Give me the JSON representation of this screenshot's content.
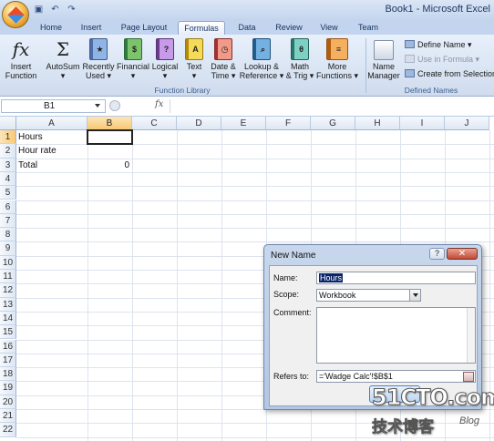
{
  "window": {
    "title": "Book1 - Microsoft Excel"
  },
  "quick_access": [
    "save-icon",
    "undo-icon",
    "redo-icon"
  ],
  "ribbon_tabs": [
    {
      "label": "Home",
      "active": false
    },
    {
      "label": "Insert",
      "active": false
    },
    {
      "label": "Page Layout",
      "active": false
    },
    {
      "label": "Formulas",
      "active": true
    },
    {
      "label": "Data",
      "active": false
    },
    {
      "label": "Review",
      "active": false
    },
    {
      "label": "View",
      "active": false
    },
    {
      "label": "Team",
      "active": false
    }
  ],
  "function_library": {
    "group_label": "Function Library",
    "insert_function": {
      "glyph": "fx",
      "line1": "Insert",
      "line2": "Function"
    },
    "autosum": {
      "glyph": "Σ",
      "line1": "AutoSum",
      "line2": "▾"
    },
    "recently_used": {
      "line1": "Recently",
      "line2": "Used ▾"
    },
    "financial": {
      "line1": "Financial",
      "line2": "▾",
      "glyph": "$"
    },
    "logical": {
      "line1": "Logical",
      "line2": "▾",
      "glyph": "?"
    },
    "text": {
      "line1": "Text",
      "line2": "▾",
      "glyph": "A"
    },
    "date_time": {
      "line1": "Date &",
      "line2": "Time ▾",
      "glyph": "◷"
    },
    "lookup_reference": {
      "line1": "Lookup &",
      "line2": "Reference ▾",
      "glyph": "⌕"
    },
    "math_trig": {
      "line1": "Math",
      "line2": "& Trig ▾",
      "glyph": "θ"
    },
    "more_functions": {
      "line1": "More",
      "line2": "Functions ▾"
    }
  },
  "defined_names": {
    "group_label": "Defined Names",
    "name_manager": {
      "line1": "Name",
      "line2": "Manager"
    },
    "define_name": "Define Name ▾",
    "use_in_formula": "Use in Formula ▾",
    "create_from_selection": "Create from Selection"
  },
  "formula_bar": {
    "name_box": "B1",
    "fx_label": "fx",
    "formula": ""
  },
  "sheet": {
    "columns": [
      "A",
      "B",
      "C",
      "D",
      "E",
      "F",
      "G",
      "H",
      "I",
      "J"
    ],
    "selected_column": "B",
    "rows": [
      "1",
      "2",
      "3",
      "4",
      "5",
      "6",
      "7",
      "8",
      "9",
      "10",
      "11",
      "12",
      "13",
      "14",
      "15",
      "16",
      "17",
      "18",
      "19",
      "20",
      "21",
      "22"
    ],
    "selected_row": "1",
    "cells": {
      "A1": "Hours",
      "A2": "Hour rate",
      "A3": "Total",
      "B3": "0"
    }
  },
  "dialog": {
    "title": "New Name",
    "help_label": "?",
    "close_label": "✕",
    "name_label": "Name:",
    "name_value": "Hours",
    "scope_label": "Scope:",
    "scope_value": "Workbook",
    "comment_label": "Comment:",
    "comment_value": "",
    "refers_label": "Refers to:",
    "refers_value": "='Wadge Calc'!$B$1"
  },
  "watermark": {
    "main": "51CTO.com",
    "sub": "技术博客",
    "blog": "Blog"
  }
}
